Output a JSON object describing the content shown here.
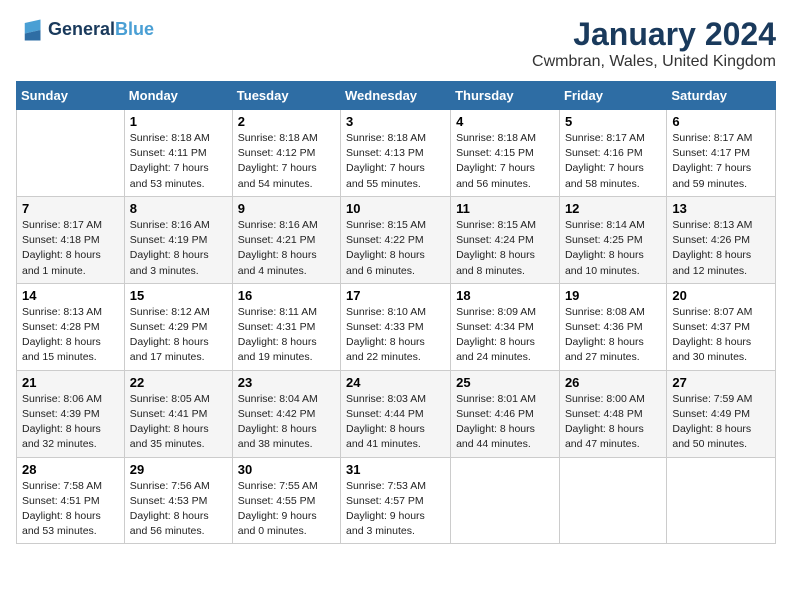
{
  "header": {
    "logo_line1": "General",
    "logo_line2": "Blue",
    "month": "January 2024",
    "location": "Cwmbran, Wales, United Kingdom"
  },
  "weekdays": [
    "Sunday",
    "Monday",
    "Tuesday",
    "Wednesday",
    "Thursday",
    "Friday",
    "Saturday"
  ],
  "weeks": [
    [
      {
        "day": "",
        "sunrise": "",
        "sunset": "",
        "daylight": ""
      },
      {
        "day": "1",
        "sunrise": "Sunrise: 8:18 AM",
        "sunset": "Sunset: 4:11 PM",
        "daylight": "Daylight: 7 hours and 53 minutes."
      },
      {
        "day": "2",
        "sunrise": "Sunrise: 8:18 AM",
        "sunset": "Sunset: 4:12 PM",
        "daylight": "Daylight: 7 hours and 54 minutes."
      },
      {
        "day": "3",
        "sunrise": "Sunrise: 8:18 AM",
        "sunset": "Sunset: 4:13 PM",
        "daylight": "Daylight: 7 hours and 55 minutes."
      },
      {
        "day": "4",
        "sunrise": "Sunrise: 8:18 AM",
        "sunset": "Sunset: 4:15 PM",
        "daylight": "Daylight: 7 hours and 56 minutes."
      },
      {
        "day": "5",
        "sunrise": "Sunrise: 8:17 AM",
        "sunset": "Sunset: 4:16 PM",
        "daylight": "Daylight: 7 hours and 58 minutes."
      },
      {
        "day": "6",
        "sunrise": "Sunrise: 8:17 AM",
        "sunset": "Sunset: 4:17 PM",
        "daylight": "Daylight: 7 hours and 59 minutes."
      }
    ],
    [
      {
        "day": "7",
        "sunrise": "Sunrise: 8:17 AM",
        "sunset": "Sunset: 4:18 PM",
        "daylight": "Daylight: 8 hours and 1 minute."
      },
      {
        "day": "8",
        "sunrise": "Sunrise: 8:16 AM",
        "sunset": "Sunset: 4:19 PM",
        "daylight": "Daylight: 8 hours and 3 minutes."
      },
      {
        "day": "9",
        "sunrise": "Sunrise: 8:16 AM",
        "sunset": "Sunset: 4:21 PM",
        "daylight": "Daylight: 8 hours and 4 minutes."
      },
      {
        "day": "10",
        "sunrise": "Sunrise: 8:15 AM",
        "sunset": "Sunset: 4:22 PM",
        "daylight": "Daylight: 8 hours and 6 minutes."
      },
      {
        "day": "11",
        "sunrise": "Sunrise: 8:15 AM",
        "sunset": "Sunset: 4:24 PM",
        "daylight": "Daylight: 8 hours and 8 minutes."
      },
      {
        "day": "12",
        "sunrise": "Sunrise: 8:14 AM",
        "sunset": "Sunset: 4:25 PM",
        "daylight": "Daylight: 8 hours and 10 minutes."
      },
      {
        "day": "13",
        "sunrise": "Sunrise: 8:13 AM",
        "sunset": "Sunset: 4:26 PM",
        "daylight": "Daylight: 8 hours and 12 minutes."
      }
    ],
    [
      {
        "day": "14",
        "sunrise": "Sunrise: 8:13 AM",
        "sunset": "Sunset: 4:28 PM",
        "daylight": "Daylight: 8 hours and 15 minutes."
      },
      {
        "day": "15",
        "sunrise": "Sunrise: 8:12 AM",
        "sunset": "Sunset: 4:29 PM",
        "daylight": "Daylight: 8 hours and 17 minutes."
      },
      {
        "day": "16",
        "sunrise": "Sunrise: 8:11 AM",
        "sunset": "Sunset: 4:31 PM",
        "daylight": "Daylight: 8 hours and 19 minutes."
      },
      {
        "day": "17",
        "sunrise": "Sunrise: 8:10 AM",
        "sunset": "Sunset: 4:33 PM",
        "daylight": "Daylight: 8 hours and 22 minutes."
      },
      {
        "day": "18",
        "sunrise": "Sunrise: 8:09 AM",
        "sunset": "Sunset: 4:34 PM",
        "daylight": "Daylight: 8 hours and 24 minutes."
      },
      {
        "day": "19",
        "sunrise": "Sunrise: 8:08 AM",
        "sunset": "Sunset: 4:36 PM",
        "daylight": "Daylight: 8 hours and 27 minutes."
      },
      {
        "day": "20",
        "sunrise": "Sunrise: 8:07 AM",
        "sunset": "Sunset: 4:37 PM",
        "daylight": "Daylight: 8 hours and 30 minutes."
      }
    ],
    [
      {
        "day": "21",
        "sunrise": "Sunrise: 8:06 AM",
        "sunset": "Sunset: 4:39 PM",
        "daylight": "Daylight: 8 hours and 32 minutes."
      },
      {
        "day": "22",
        "sunrise": "Sunrise: 8:05 AM",
        "sunset": "Sunset: 4:41 PM",
        "daylight": "Daylight: 8 hours and 35 minutes."
      },
      {
        "day": "23",
        "sunrise": "Sunrise: 8:04 AM",
        "sunset": "Sunset: 4:42 PM",
        "daylight": "Daylight: 8 hours and 38 minutes."
      },
      {
        "day": "24",
        "sunrise": "Sunrise: 8:03 AM",
        "sunset": "Sunset: 4:44 PM",
        "daylight": "Daylight: 8 hours and 41 minutes."
      },
      {
        "day": "25",
        "sunrise": "Sunrise: 8:01 AM",
        "sunset": "Sunset: 4:46 PM",
        "daylight": "Daylight: 8 hours and 44 minutes."
      },
      {
        "day": "26",
        "sunrise": "Sunrise: 8:00 AM",
        "sunset": "Sunset: 4:48 PM",
        "daylight": "Daylight: 8 hours and 47 minutes."
      },
      {
        "day": "27",
        "sunrise": "Sunrise: 7:59 AM",
        "sunset": "Sunset: 4:49 PM",
        "daylight": "Daylight: 8 hours and 50 minutes."
      }
    ],
    [
      {
        "day": "28",
        "sunrise": "Sunrise: 7:58 AM",
        "sunset": "Sunset: 4:51 PM",
        "daylight": "Daylight: 8 hours and 53 minutes."
      },
      {
        "day": "29",
        "sunrise": "Sunrise: 7:56 AM",
        "sunset": "Sunset: 4:53 PM",
        "daylight": "Daylight: 8 hours and 56 minutes."
      },
      {
        "day": "30",
        "sunrise": "Sunrise: 7:55 AM",
        "sunset": "Sunset: 4:55 PM",
        "daylight": "Daylight: 9 hours and 0 minutes."
      },
      {
        "day": "31",
        "sunrise": "Sunrise: 7:53 AM",
        "sunset": "Sunset: 4:57 PM",
        "daylight": "Daylight: 9 hours and 3 minutes."
      },
      {
        "day": "",
        "sunrise": "",
        "sunset": "",
        "daylight": ""
      },
      {
        "day": "",
        "sunrise": "",
        "sunset": "",
        "daylight": ""
      },
      {
        "day": "",
        "sunrise": "",
        "sunset": "",
        "daylight": ""
      }
    ]
  ]
}
